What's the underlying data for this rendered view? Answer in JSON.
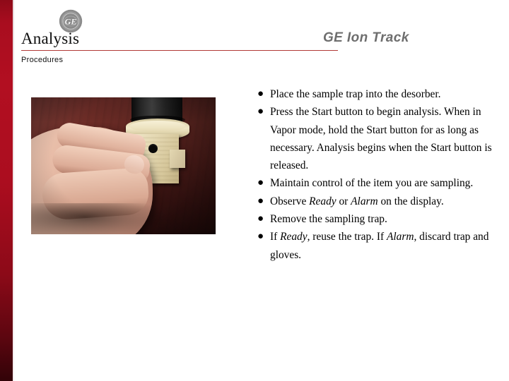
{
  "slide": {
    "title": "Analysis",
    "subtitle": "Procedures",
    "brand": "GE Ion Track",
    "logo_icon": "ge-monogram-icon",
    "logo_text": "GE",
    "accent_bar_color": "#a90d1f",
    "rule_color": "#b23a36",
    "brand_color": "#6e6e6e"
  },
  "photo": {
    "alt": "Hand inserting a sample trap card into the desorber of a GE Ion Track analyzer on a dark wooden desk",
    "icon": "sample-trap-insertion-photo"
  },
  "bullets": [
    {
      "marker": "●",
      "parts": [
        {
          "text": "Place the sample trap into the desorber.",
          "italic": false
        }
      ]
    },
    {
      "marker": "●",
      "parts": [
        {
          "text": "Press the Start button to begin analysis. When in Vapor mode, hold the Start button for as long as necessary. Analysis begins when the Start button is released.",
          "italic": false
        }
      ]
    },
    {
      "marker": "●",
      "parts": [
        {
          "text": "Maintain control of the item you are sampling.",
          "italic": false
        }
      ]
    },
    {
      "marker": "●",
      "parts": [
        {
          "text": "Observe ",
          "italic": false
        },
        {
          "text": "Ready",
          "italic": true
        },
        {
          "text": " or ",
          "italic": false
        },
        {
          "text": "Alarm",
          "italic": true
        },
        {
          "text": " on the display.",
          "italic": false
        }
      ]
    },
    {
      "marker": "●",
      "parts": [
        {
          "text": "Remove the sampling trap.",
          "italic": false
        }
      ]
    },
    {
      "marker": "●",
      "parts": [
        {
          "text": "If ",
          "italic": false
        },
        {
          "text": "Ready",
          "italic": true
        },
        {
          "text": ", reuse the trap.  If ",
          "italic": false
        },
        {
          "text": "Alarm",
          "italic": true
        },
        {
          "text": ", discard trap and gloves.",
          "italic": false
        }
      ]
    }
  ]
}
